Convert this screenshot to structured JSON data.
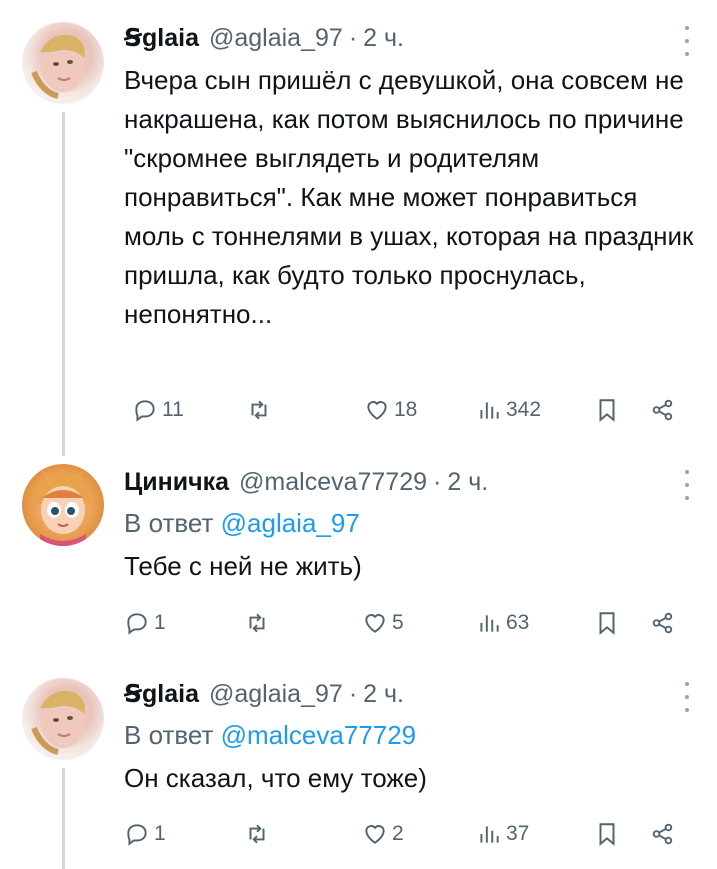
{
  "tweets": [
    {
      "name": "Ꞩglaia",
      "handle": "@aglaia_97",
      "dot": "·",
      "time": "2 ч.",
      "text": "Вчера сын пришёл с девушкой, она совсем не накрашена, как потом выяснилось по причине \"скромнее выглядеть и родителям понравиться\". Как мне может понравиться моль с тоннелями в ушах, которая на праздник пришла, как будто только проснулась, непонятно...",
      "replies": "11",
      "retweets": "",
      "likes": "18",
      "views": "342"
    },
    {
      "name": "Циничка",
      "handle": "@malceva77729",
      "dot": "·",
      "time": "2 ч.",
      "reply_prefix": "В ответ",
      "reply_mention": "@aglaia_97",
      "text": "Тебе с ней не жить)",
      "replies": "1",
      "retweets": "",
      "likes": "5",
      "views": "63"
    },
    {
      "name": "Ꞩglaia",
      "handle": "@aglaia_97",
      "dot": "·",
      "time": "2 ч.",
      "reply_prefix": "В ответ",
      "reply_mention": "@malceva77729",
      "text": "Он сказал, что ему тоже)",
      "replies": "1",
      "retweets": "",
      "likes": "2",
      "views": "37"
    }
  ],
  "icons": {
    "reply": "reply-icon",
    "retweet": "retweet-icon",
    "like": "heart-icon",
    "views": "views-icon",
    "bookmark": "bookmark-icon",
    "share": "share-icon",
    "more": "more-vertical-icon"
  },
  "colors": {
    "text": "#0f1419",
    "secondary": "#536471",
    "link": "#1d9bf0",
    "thread_line": "#cfd9de"
  }
}
